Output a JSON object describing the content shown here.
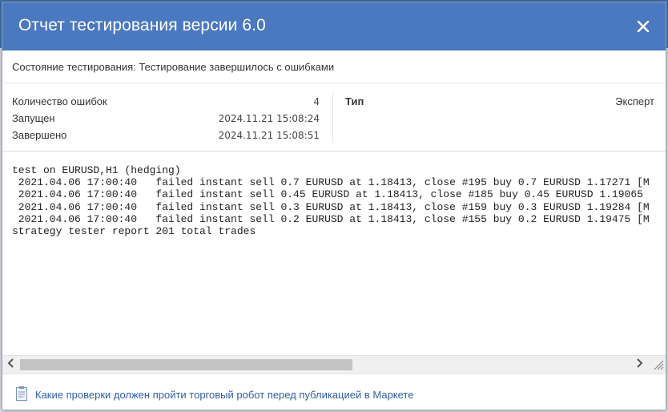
{
  "dialog": {
    "title": "Отчет тестирования версии 6.0",
    "close_icon": "close-icon"
  },
  "status": {
    "text": "Состояние тестирования: Тестирование завершилось с ошибками"
  },
  "info": {
    "errors_label": "Количество ошибок",
    "errors_value": "4",
    "started_label": "Запущен",
    "started_value": "2024.11.21 15:08:24",
    "finished_label": "Завершено",
    "finished_value": "2024.11.21 15:08:51",
    "type_label": "Тип",
    "type_value": "Эксперт"
  },
  "log": {
    "lines": [
      "test on EURUSD,H1 (hedging)",
      " 2021.04.06 17:00:40   failed instant sell 0.7 EURUSD at 1.18413, close #195 buy 0.7 EURUSD 1.17271 [M",
      " 2021.04.06 17:00:40   failed instant sell 0.45 EURUSD at 1.18413, close #185 buy 0.45 EURUSD 1.19065",
      " 2021.04.06 17:00:40   failed instant sell 0.3 EURUSD at 1.18413, close #159 buy 0.3 EURUSD 1.19284 [M",
      " 2021.04.06 17:00:40   failed instant sell 0.2 EURUSD at 1.18413, close #155 buy 0.2 EURUSD 1.19475 [M",
      "strategy tester report 201 total trades"
    ]
  },
  "scrollbar": {
    "left_arrow": "‹",
    "right_arrow": "›"
  },
  "footer": {
    "link_text": "Какие проверки должен пройти торговый робот перед публикацией в Маркете",
    "icon": "document-icon"
  },
  "colors": {
    "titlebar": "#4a79bf",
    "link": "#2f5ea6"
  }
}
